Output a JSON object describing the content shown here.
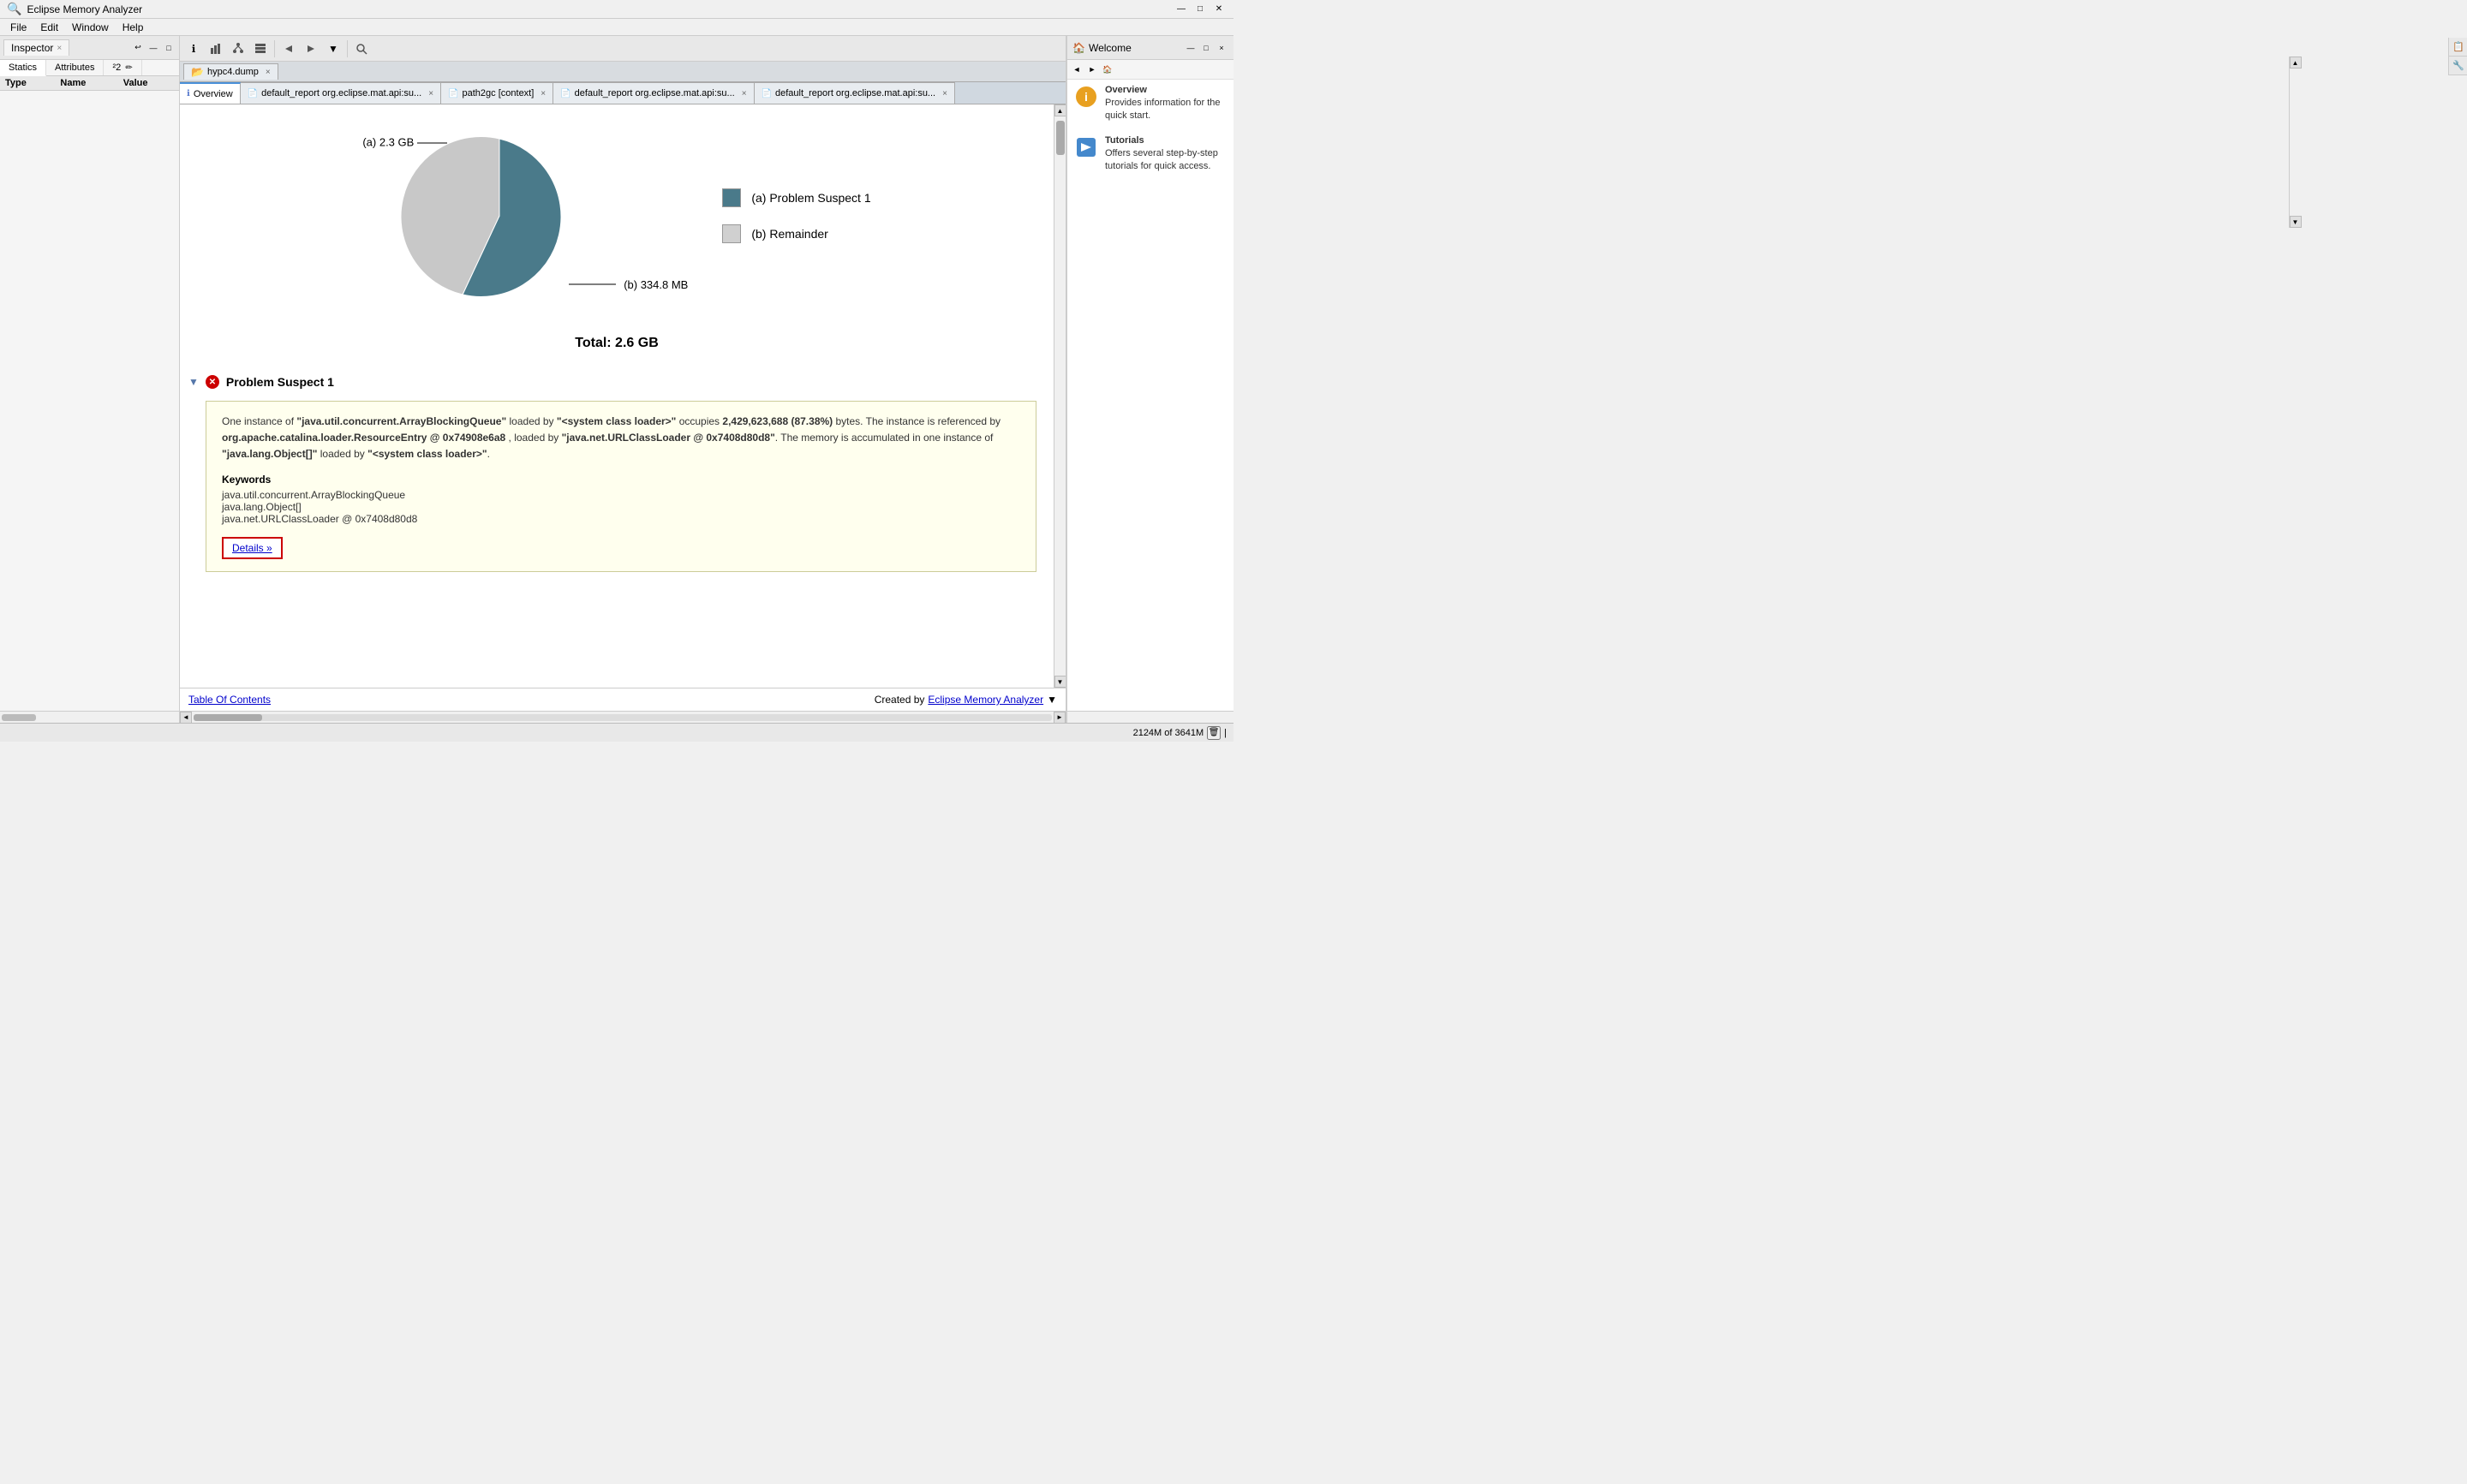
{
  "app": {
    "title": "Eclipse Memory Analyzer",
    "icon": "🔍"
  },
  "title_bar": {
    "title": "Eclipse Memory Analyzer",
    "minimize": "—",
    "maximize": "□",
    "close": "✕"
  },
  "menu": {
    "items": [
      "File",
      "Edit",
      "Window",
      "Help"
    ]
  },
  "inspector": {
    "panel_title": "Inspector",
    "close_icon": "×",
    "minimize_icon": "—",
    "maximize_icon": "□",
    "back_icon": "↩",
    "tabs": [
      "Statics",
      "Attributes",
      "²2"
    ],
    "active_tab": "Statics",
    "table_headers": [
      "Type",
      "Name",
      "Value"
    ],
    "rows": []
  },
  "toolbar": {
    "buttons": [
      {
        "name": "info-icon",
        "label": "ℹ",
        "tooltip": "Info"
      },
      {
        "name": "chart-icon",
        "label": "📊",
        "tooltip": "Chart"
      },
      {
        "name": "tree-icon",
        "label": "🌳",
        "tooltip": "Tree"
      },
      {
        "name": "list-icon",
        "label": "📋",
        "tooltip": "List"
      },
      {
        "name": "nav-back-icon",
        "label": "◀",
        "tooltip": "Back"
      },
      {
        "name": "nav-fwd-icon",
        "label": "▶",
        "tooltip": "Forward"
      },
      {
        "name": "dropdown-icon",
        "label": "▼",
        "tooltip": "Dropdown"
      },
      {
        "name": "search-icon",
        "label": "🔍",
        "tooltip": "Search"
      }
    ]
  },
  "tabs": [
    {
      "id": "overview",
      "label": "Overview",
      "icon": "ℹ",
      "active": true,
      "closable": false
    },
    {
      "id": "default_report_1",
      "label": "default_report  org.eclipse.mat.api:su...",
      "icon": "📄",
      "active": false,
      "closable": true
    },
    {
      "id": "path2gc",
      "label": "path2gc  [context]",
      "icon": "📄",
      "active": false,
      "closable": true
    },
    {
      "id": "default_report_2",
      "label": "default_report  org.eclipse.mat.api:su...",
      "icon": "📄",
      "active": false,
      "closable": true
    },
    {
      "id": "default_report_3",
      "label": "default_report  org.eclipse.mat.api:su...",
      "icon": "📄",
      "active": false,
      "closable": true
    }
  ],
  "dump_tab": {
    "label": "hypc4.dump",
    "closable": true
  },
  "chart": {
    "title": "Pie Chart",
    "label_a": "(a)  2.3 GB",
    "label_b": "(b)  334.8 MB",
    "total_label": "Total: 2.6 GB",
    "legend": [
      {
        "key": "a",
        "label": "(a)  Problem Suspect 1",
        "color": "#4a7a8a"
      },
      {
        "key": "b",
        "label": "(b)  Remainder",
        "color": "#d0d0d0"
      }
    ]
  },
  "problem_suspect": {
    "section_title": "Problem Suspect 1",
    "description_parts": [
      {
        "text": "One instance of ",
        "bold": false
      },
      {
        "text": "\"java.util.concurrent.ArrayBlockingQueue\"",
        "bold": true
      },
      {
        "text": " loaded by ",
        "bold": false
      },
      {
        "text": "\"<system class loader>\"",
        "bold": true
      },
      {
        "text": " occupies ",
        "bold": false
      },
      {
        "text": "2,429,623,688 (87.38%)",
        "bold": true
      },
      {
        "text": " bytes. The instance is referenced by ",
        "bold": false
      },
      {
        "text": "org.apache.catalina.loader.ResourceEntry @ 0x74908e6a8",
        "bold": true
      },
      {
        "text": " , loaded by ",
        "bold": false
      },
      {
        "text": "\"java.net.URLClassLoader @ 0x7408d80d8\"",
        "bold": true
      },
      {
        "text": ". The memory is accumulated in one instance of ",
        "bold": false
      },
      {
        "text": "\"java.lang.Object[]\"",
        "bold": true
      },
      {
        "text": " loaded by ",
        "bold": false
      },
      {
        "text": "\"<system class loader>\"",
        "bold": true
      },
      {
        "text": ".",
        "bold": false
      }
    ],
    "keywords_title": "Keywords",
    "keywords": [
      "java.util.concurrent.ArrayBlockingQueue",
      "java.lang.Object[]",
      "java.net.URLClassLoader @ 0x7408d80d8"
    ],
    "details_link": "Details »"
  },
  "footer": {
    "table_of_contents": "Table Of Contents",
    "created_by_prefix": "Created by ",
    "created_by_link": "Eclipse Memory Analyzer",
    "dropdown_icon": "▼"
  },
  "welcome_panel": {
    "title": "Welcome",
    "items": [
      {
        "title": "Overview",
        "description": "Provides information for the quick start.",
        "icon_color": "#e8a020"
      },
      {
        "title": "Tutorials",
        "description": "Offers several step-by-step tutorials for quick access.",
        "icon_color": "#4488cc"
      }
    ]
  },
  "status_bar": {
    "memory_label": "2124M of 3641M",
    "gc_icon": "🗑"
  },
  "colors": {
    "accent": "#4a7a8a",
    "light_slice": "#c8c8c8",
    "tab_active_border": "#4a90d9",
    "link": "#0000cc",
    "error_red": "#cc0000",
    "suspect_bg": "#ffffee",
    "suspect_border": "#cccc99"
  }
}
